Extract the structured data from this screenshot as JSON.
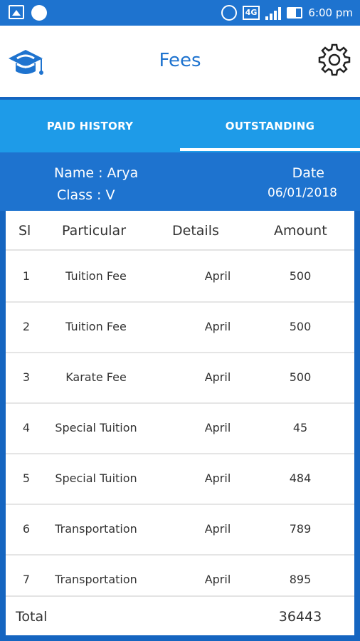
{
  "status_bar": {
    "time": "6:00 pm",
    "network": "4G",
    "icons": [
      "image-icon",
      "phone-icon",
      "alarm-icon",
      "signal-icon",
      "battery-icon"
    ]
  },
  "app_bar": {
    "title": "Fees",
    "logo_icon": "graduation-cap-logo",
    "settings_icon": "gear-icon",
    "accent_color": "#1e73cf"
  },
  "tabs": [
    {
      "label": "PAID HISTORY",
      "selected": false
    },
    {
      "label": "OUTSTANDING",
      "selected": true
    }
  ],
  "student": {
    "name": "Name : Arya",
    "class": "Class : V",
    "date_label": "Date",
    "date": "06/01/2018"
  },
  "table": {
    "headers": [
      "Sl",
      "Particular",
      "Details",
      "Amount"
    ],
    "rows": [
      {
        "sl": "1",
        "particular": "Tuition Fee",
        "details": "April",
        "amount": "500"
      },
      {
        "sl": "2",
        "particular": "Tuition Fee",
        "details": "April",
        "amount": "500"
      },
      {
        "sl": "3",
        "particular": "Karate Fee",
        "details": "April",
        "amount": "500"
      },
      {
        "sl": "4",
        "particular": "Special Tuition",
        "details": "April",
        "amount": "45"
      },
      {
        "sl": "5",
        "particular": "Special Tuition",
        "details": "April",
        "amount": "484"
      },
      {
        "sl": "6",
        "particular": "Transportation",
        "details": "April",
        "amount": "789"
      },
      {
        "sl": "7",
        "particular": "Transportation",
        "details": "April",
        "amount": "895"
      }
    ],
    "total_label": "Total",
    "total_value": "36443"
  }
}
